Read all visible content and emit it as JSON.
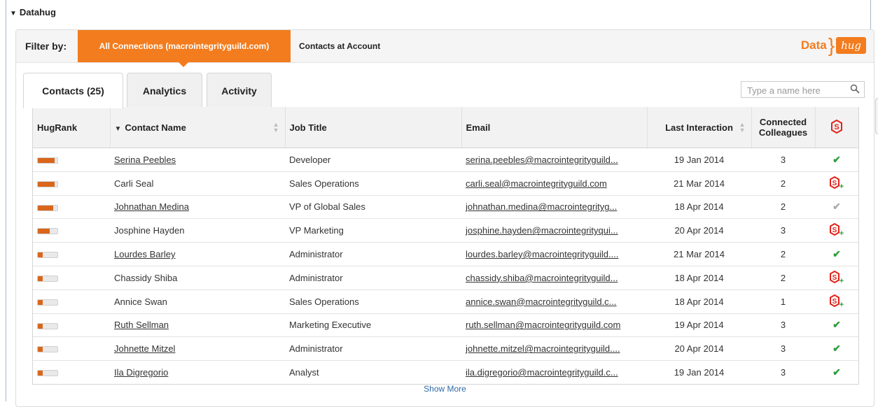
{
  "section": {
    "title": "Datahug"
  },
  "filter": {
    "label": "Filter by:",
    "active": "All Connections (macrointegrityguild.com)",
    "other": "Contacts at Account"
  },
  "logo": {
    "data_text": "Data",
    "hug_text": "hug"
  },
  "tabs": [
    {
      "label": "Contacts (25)"
    },
    {
      "label": "Analytics"
    },
    {
      "label": "Activity"
    }
  ],
  "search": {
    "placeholder": "Type a name here",
    "value": ""
  },
  "table": {
    "headers": {
      "hugrank": "HugRank",
      "contact_name": "Contact Name",
      "job_title": "Job Title",
      "email": "Email",
      "last_interaction": "Last Interaction",
      "connected_colleagues": "Connected Colleagues"
    },
    "rows": [
      {
        "rank": 0.85,
        "name": "Serina Peebles",
        "linked": true,
        "title": "Developer",
        "email": "serina.peebles@macrointegrityguild...",
        "last": "19 Jan 2014",
        "colleagues": "3",
        "status": "check"
      },
      {
        "rank": 0.85,
        "name": "Carli Seal",
        "linked": false,
        "title": "Sales Operations",
        "email": "carli.seal@macrointegrityguild.com",
        "last": "21 Mar 2014",
        "colleagues": "2",
        "status": "add"
      },
      {
        "rank": 0.8,
        "name": "Johnathan Medina",
        "linked": true,
        "title": "VP of Global Sales",
        "email": "johnathan.medina@macrointegrityg...",
        "last": "18 Apr 2014",
        "colleagues": "2",
        "status": "check-grey"
      },
      {
        "rank": 0.6,
        "name": "Josphine Hayden",
        "linked": false,
        "title": "VP Marketing",
        "email": "josphine.hayden@macrointegrityqui...",
        "last": "20 Apr 2014",
        "colleagues": "3",
        "status": "add"
      },
      {
        "rank": 0.25,
        "name": "Lourdes Barley",
        "linked": true,
        "title": "Administrator",
        "email": "lourdes.barley@macrointegrityguild....",
        "last": "21 Mar 2014",
        "colleagues": "2",
        "status": "check"
      },
      {
        "rank": 0.25,
        "name": "Chassidy Shiba",
        "linked": false,
        "title": "Administrator",
        "email": "chassidy.shiba@macrointegrityguild...",
        "last": "18 Apr 2014",
        "colleagues": "2",
        "status": "add"
      },
      {
        "rank": 0.25,
        "name": "Annice Swan",
        "linked": false,
        "title": "Sales Operations",
        "email": "annice.swan@macrointegrityguild.c...",
        "last": "18 Apr 2014",
        "colleagues": "1",
        "status": "add"
      },
      {
        "rank": 0.25,
        "name": "Ruth Sellman",
        "linked": true,
        "title": "Marketing Executive",
        "email": "ruth.sellman@macrointegrityguild.com",
        "last": "19 Apr 2014",
        "colleagues": "3",
        "status": "check"
      },
      {
        "rank": 0.25,
        "name": "Johnette Mitzel",
        "linked": true,
        "title": "Administrator",
        "email": "johnette.mitzel@macrointegrityguild....",
        "last": "20 Apr 2014",
        "colleagues": "3",
        "status": "check"
      },
      {
        "rank": 0.25,
        "name": "Ila Digregorio",
        "linked": true,
        "title": "Analyst",
        "email": "ila.digregorio@macrointegrityguild.c...",
        "last": "19 Jan 2014",
        "colleagues": "3",
        "status": "check"
      }
    ]
  },
  "show_more": "Show More",
  "colors": {
    "accent": "#f27c1e",
    "hugbar": "#d9661a",
    "check": "#2e9e3a",
    "salesforce_red": "#e2231a",
    "link_blue": "#2f6aa7"
  },
  "icons": {
    "salesforce": "salesforce-s-icon",
    "add": "salesforce-add-icon",
    "check": "check-icon",
    "search": "search-icon"
  }
}
